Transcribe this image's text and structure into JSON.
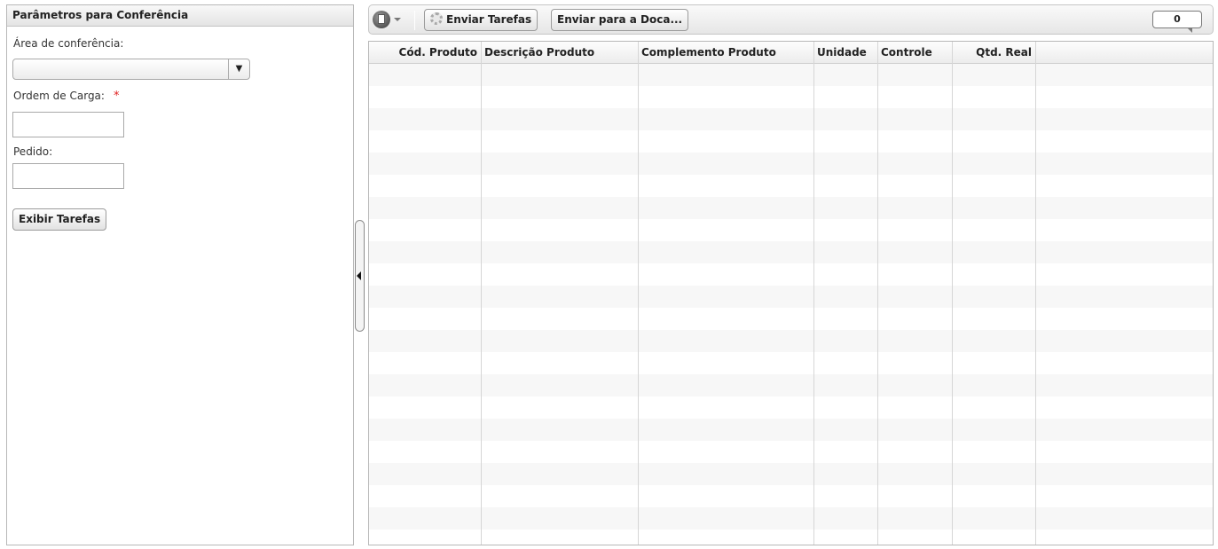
{
  "left_panel": {
    "title": "Parâmetros para Conferência",
    "area_label": "Área de conferência:",
    "area_value": "",
    "ordem_label": "Ordem de Carga:",
    "required_mark": "*",
    "ordem_value": "",
    "pedido_label": "Pedido:",
    "pedido_value": "",
    "exibir_button": "Exibir Tarefas"
  },
  "toolbar": {
    "enviar_tarefas": "Enviar Tarefas",
    "enviar_doca": "Enviar para a Doca...",
    "counter": "0"
  },
  "grid": {
    "columns": [
      "Cód. Produto",
      "Descrição Produto",
      "Complemento Produto",
      "Unidade",
      "Controle",
      "Qtd. Real"
    ],
    "rows": []
  },
  "icons": {
    "dropdown": "chevron-down-icon",
    "document_menu": "document-menu-icon",
    "gear": "gear-icon",
    "splitter": "collapse-left-icon"
  }
}
